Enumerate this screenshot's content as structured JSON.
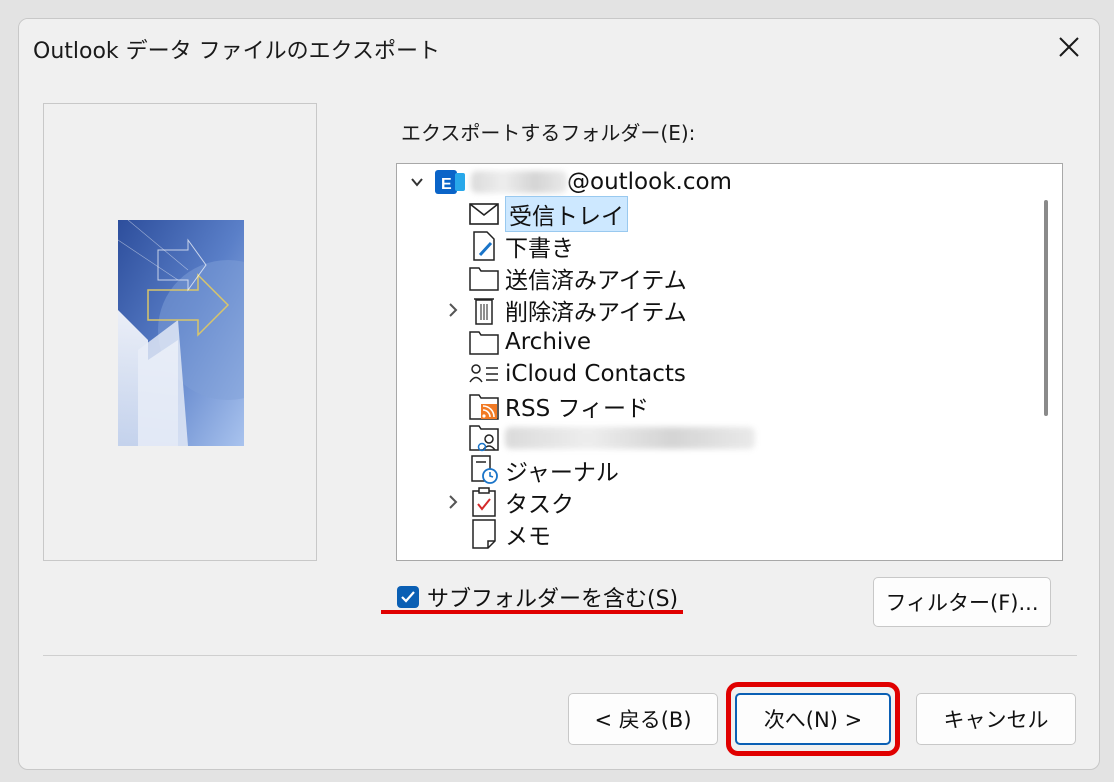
{
  "window": {
    "title": "Outlook データ ファイルのエクスポート"
  },
  "folder_label": "エクスポートするフォルダー(E):",
  "tree": {
    "account": "@outlook.com",
    "items": [
      {
        "label": "受信トレイ",
        "icon": "mail-icon",
        "selected": true
      },
      {
        "label": "下書き",
        "icon": "draft-icon"
      },
      {
        "label": "送信済みアイテム",
        "icon": "folder-icon"
      },
      {
        "label": "削除済みアイテム",
        "icon": "trash-icon",
        "expandable": true
      },
      {
        "label": "Archive",
        "icon": "folder-icon"
      },
      {
        "label": "iCloud Contacts",
        "icon": "contacts-icon"
      },
      {
        "label": "RSS フィード",
        "icon": "rss-folder-icon"
      },
      {
        "label": "",
        "icon": "contacts-folder-icon",
        "redacted": true
      },
      {
        "label": "ジャーナル",
        "icon": "journal-icon"
      },
      {
        "label": "タスク",
        "icon": "task-icon",
        "expandable": true
      },
      {
        "label": "メモ",
        "icon": "note-icon"
      }
    ]
  },
  "checkbox": {
    "label": "サブフォルダーを含む(S)",
    "checked": true
  },
  "buttons": {
    "filter": "フィルター(F)...",
    "back": "< 戻る(B)",
    "next": "次へ(N) >",
    "cancel": "キャンセル"
  },
  "colors": {
    "accent": "#0a5fb4",
    "highlight": "#e00000",
    "selection": "#cde8ff"
  }
}
